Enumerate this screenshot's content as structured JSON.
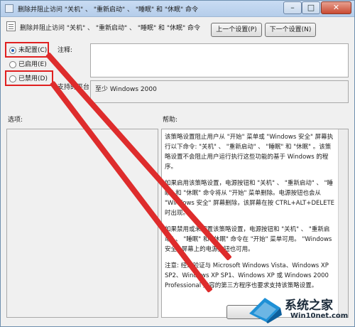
{
  "window": {
    "title": "删除并阻止访问 \"关机\" 、 \"重新启动\" 、 \"睡眠\" 和 \"休眠\" 命令",
    "header_title": "删除并阻止访问 \"关机\" 、 \"重新启动\" 、 \"睡眠\" 和 \"休眠\" 命令",
    "minimize_glyph": "–",
    "maximize_glyph": "□",
    "close_glyph": "✕"
  },
  "nav": {
    "prev_label": "上一个设置(P)",
    "next_label": "下一个设置(N)"
  },
  "options": {
    "not_configured": "未配置(C)",
    "enabled": "已启用(E)",
    "disabled": "已禁用(D)",
    "selected": "not_configured"
  },
  "labels": {
    "comment": "注释:",
    "supported_on": "支持的平台:",
    "supported_value": "至少 Windows 2000",
    "options_header": "选项:",
    "help_header": "帮助:"
  },
  "help": {
    "p1": "该策略设置阻止用户从 \"开始\" 菜单或 \"Windows 安全\" 屏幕执行以下命令: \"关机\" 、 \"重新启动\" 、 \"睡眠\" 和 \"休眠\" 。该策略设置不会阻止用户运行执行这些功能的基于 Windows 的程序。",
    "p2": "如果启用该策略设置，电源按钮和 \"关机\" 、 \"重新启动\" 、 \"睡眠\" 和 \"休眠\" 命令将从 \"开始\" 菜单删除。电源按钮也会从 \"Windows 安全\" 屏幕删除，该屏幕在按 CTRL+ALT+DELETE 时出现。",
    "p3": "如果禁用或未配置该策略设置，电源按钮和 \"关机\" 、 \"重新启动\" 、 \"睡眠\" 和 \"休眠\" 命令在 \"开始\" 菜单可用。 \"Windows 安全\" 屏幕上的电源按钮也可用。",
    "p4": "注意: 经过验证与 Microsoft Windows Vista、Windows XP SP2、Windows XP SP1、Windows XP 或 Windows 2000 Professional 兼容的第三方程序也要求支持该策略设置。"
  },
  "watermark": {
    "name": "系统之家",
    "url": "Win10net.com"
  },
  "colors": {
    "annotation_red": "#e02020",
    "titlebar": "#c9dcf3"
  }
}
